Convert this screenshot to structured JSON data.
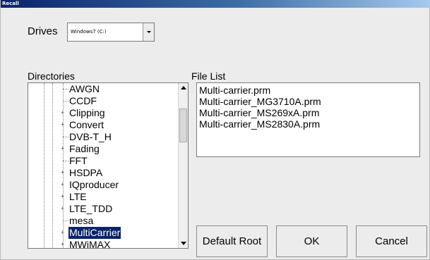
{
  "window": {
    "title": "Recall"
  },
  "drives": {
    "label": "Drives",
    "selected": "Windows7 (C:)"
  },
  "directories": {
    "label": "Directories",
    "items": [
      {
        "label": "AWGN",
        "expandable": false,
        "selected": false
      },
      {
        "label": "CCDF",
        "expandable": false,
        "selected": false
      },
      {
        "label": "Clipping",
        "expandable": true,
        "selected": false
      },
      {
        "label": "Convert",
        "expandable": true,
        "selected": false
      },
      {
        "label": "DVB-T_H",
        "expandable": false,
        "selected": false
      },
      {
        "label": "Fading",
        "expandable": true,
        "selected": false
      },
      {
        "label": "FFT",
        "expandable": false,
        "selected": false
      },
      {
        "label": "HSDPA",
        "expandable": true,
        "selected": false
      },
      {
        "label": "IQproducer",
        "expandable": true,
        "selected": false
      },
      {
        "label": "LTE",
        "expandable": true,
        "selected": false
      },
      {
        "label": "LTE_TDD",
        "expandable": true,
        "selected": false
      },
      {
        "label": "mesa",
        "expandable": false,
        "selected": false
      },
      {
        "label": "MultiCarrier",
        "expandable": true,
        "selected": true
      },
      {
        "label": "MWiMAX",
        "expandable": true,
        "selected": false
      }
    ]
  },
  "file_list": {
    "label": "File List",
    "items": [
      "Multi-carrier.prm",
      "Multi-carrier_MG3710A.prm",
      "Multi-carrier_MS269xA.prm",
      "Multi-carrier_MS2830A.prm"
    ]
  },
  "buttons": {
    "default_root": "Default Root",
    "ok": "OK",
    "cancel": "Cancel"
  },
  "colors": {
    "selection": "#0a246a",
    "dialog_bg": "#ececec"
  },
  "icons": {
    "expander": "plus-expander-icon",
    "dropdown": "chevron-down-icon",
    "scroll_up": "scroll-up-arrow-icon",
    "scroll_down": "scroll-down-arrow-icon"
  }
}
